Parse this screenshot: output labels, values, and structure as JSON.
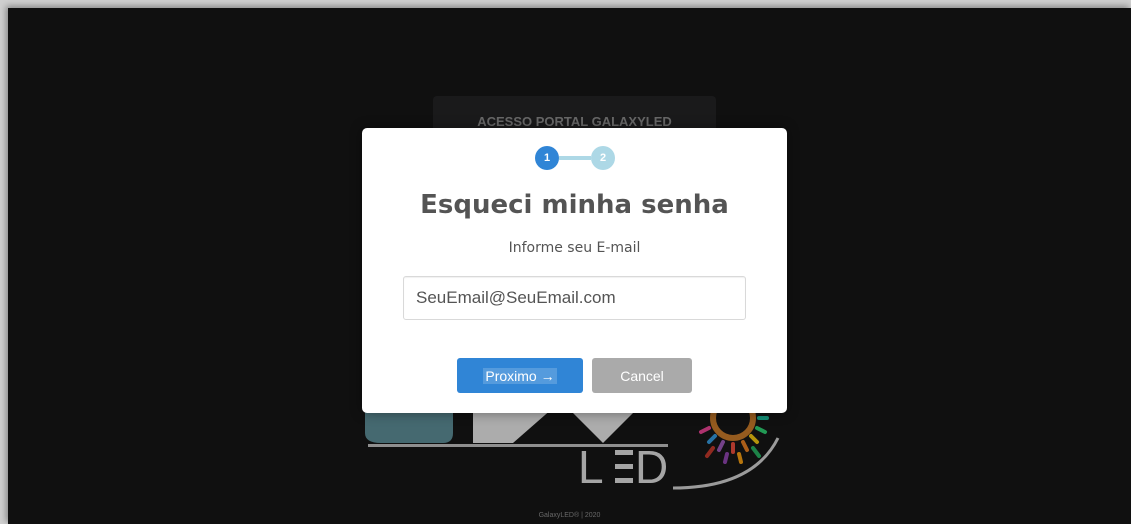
{
  "background": {
    "login_title": "ACESSO PORTAL GALAXYLED",
    "footer": "GalaxyLED® | 2020"
  },
  "modal": {
    "steps": [
      "1",
      "2"
    ],
    "active_step": "1",
    "title": "Esqueci minha senha",
    "subtitle": "Informe seu E-mail",
    "email_value": "SeuEmail@SeuEmail.com",
    "next_label": "Proximo →",
    "cancel_label": "Cancel"
  },
  "colors": {
    "primary": "#3085d6",
    "step_inactive": "#add8e6",
    "cancel": "#aaaaaa",
    "page_bg": "#161616"
  }
}
